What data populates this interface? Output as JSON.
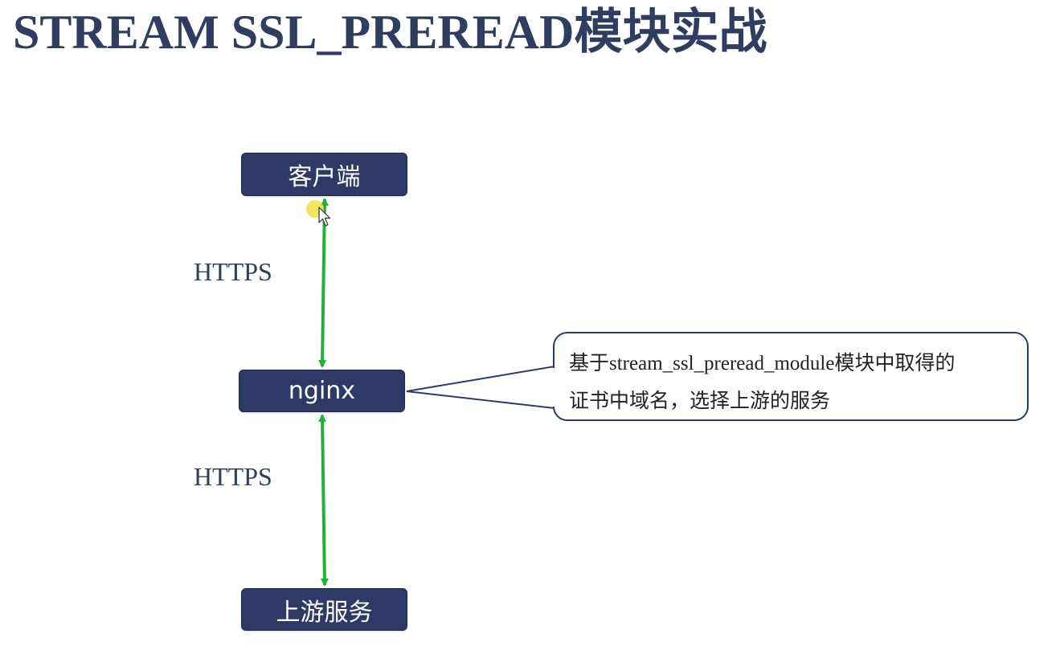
{
  "slide": {
    "title": "STREAM SSL_PREREAD模块实战"
  },
  "nodes": {
    "client": "客户端",
    "nginx": "nginx",
    "upstream": "上游服务"
  },
  "edges": {
    "top_label": "HTTPS",
    "bottom_label": "HTTPS"
  },
  "callout": {
    "line1": "基于stream_ssl_preread_module模块中取得的",
    "line2": "证书中域名，选择上游的服务"
  },
  "colors": {
    "node_fill": "#2d3a66",
    "title": "#2e3d60",
    "arrow": "#1fb13a"
  }
}
